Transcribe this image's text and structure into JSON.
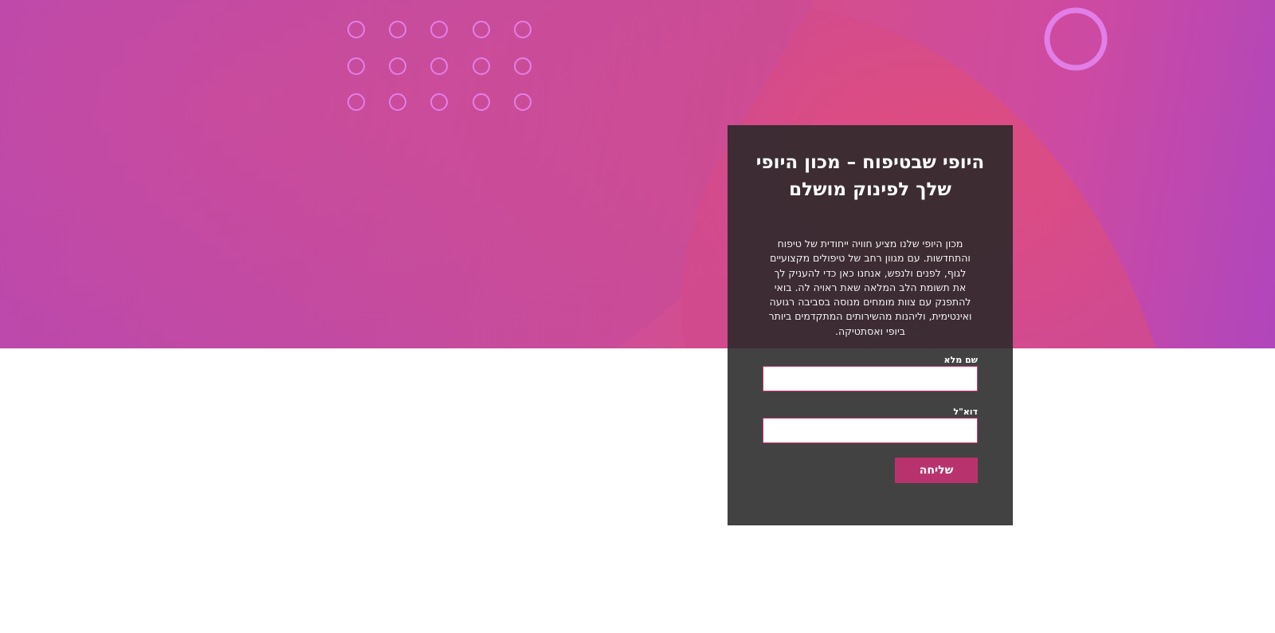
{
  "hero": {
    "title": "היופי שבטיפוח – מכון היופי שלך לפינוק מושלם",
    "description": "מכון היופי שלנו מציע חוויה ייחודית של טיפוח והתחדשות. עם מגוון רחב של טיפולים מקצועיים לגוף, לפנים ולנפש, אנחנו כאן כדי להעניק לך את תשומת הלב המלאה שאת ראויה לה. בואי להתפנק עם צוות מומחים מנוסה בסביבה רגועה ואינטימית, וליהנות מהשירותים המתקדמים ביותר ביופי ואסתטיקה."
  },
  "form": {
    "name_label": "שם מלא",
    "email_label": "דוא\"ל",
    "submit_label": "שליחה"
  },
  "colors": {
    "accent": "#b8336d",
    "input_border": "#c2356c",
    "card_background": "#444444",
    "hero_gradient_start": "#ac46c6",
    "hero_gradient_mid": "#d54e8c"
  }
}
